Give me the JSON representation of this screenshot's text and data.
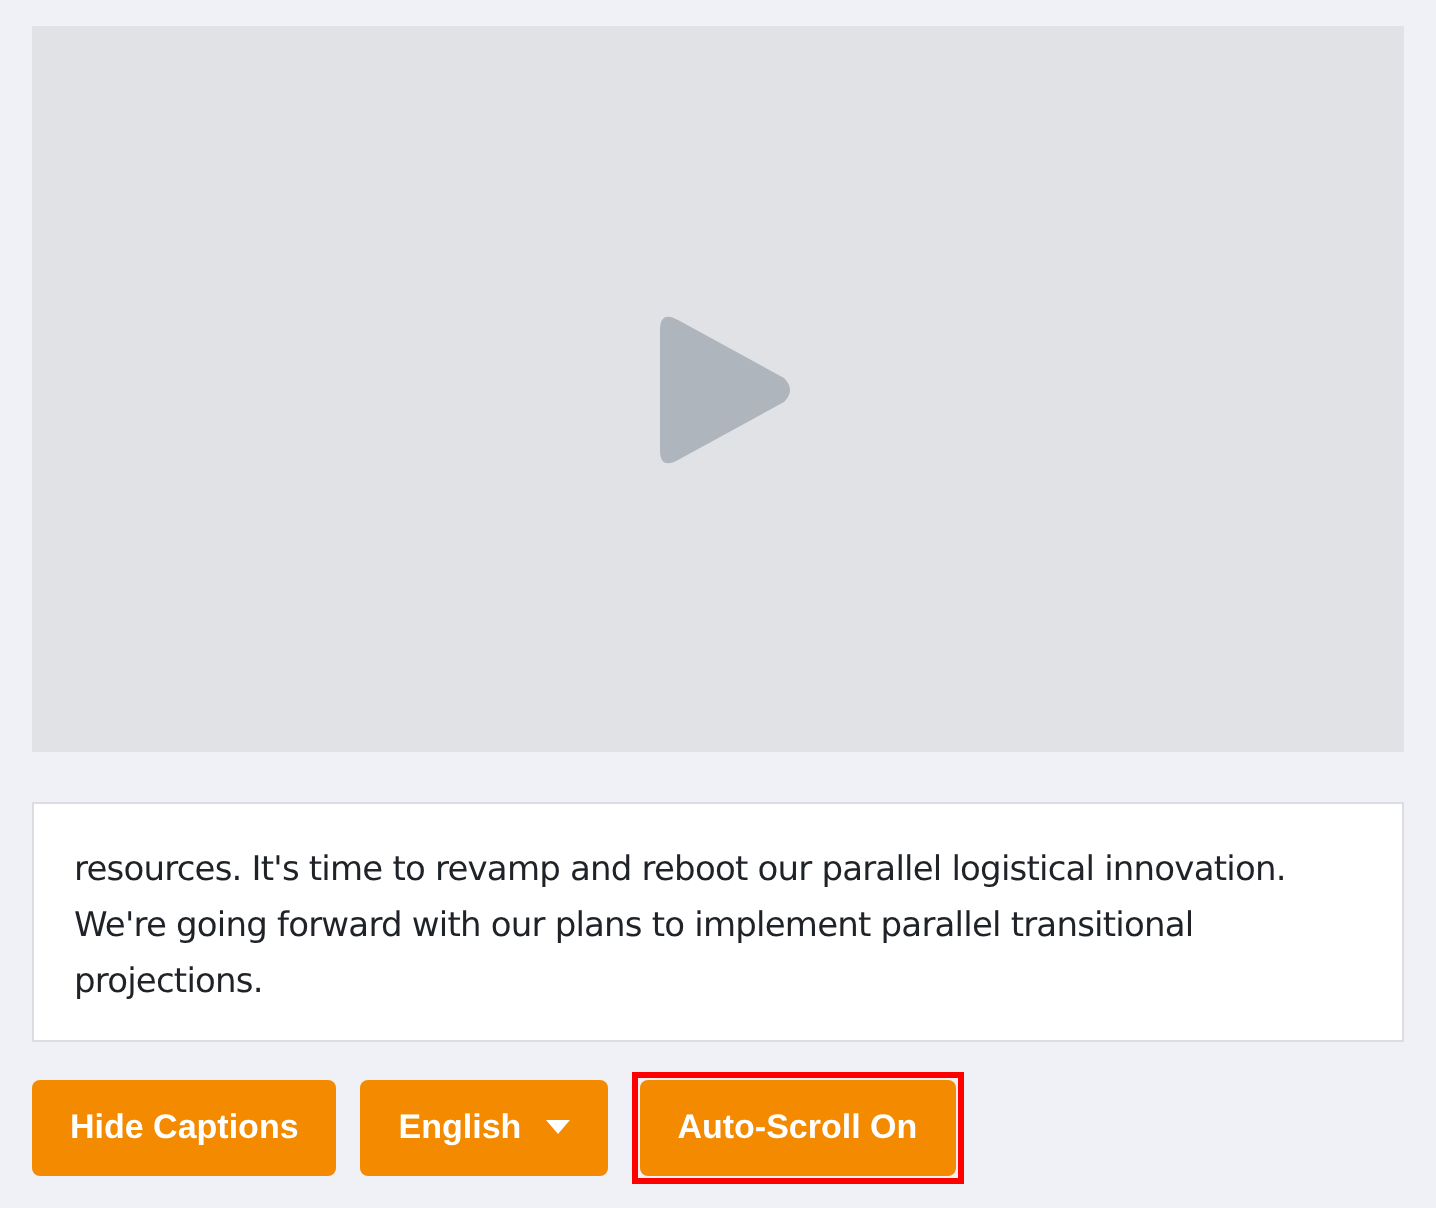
{
  "video": {
    "playing": false
  },
  "caption": "resources. It's time to revamp and reboot our parallel logistical innovation. We're going forward with our plans to implement parallel transitional projections.",
  "buttons": [
    {
      "label": "Hide Captions",
      "kind": "plain",
      "highlighted": false
    },
    {
      "label": "English",
      "kind": "dropdown",
      "highlighted": false
    },
    {
      "label": "Auto-Scroll On",
      "kind": "plain",
      "highlighted": true
    }
  ]
}
